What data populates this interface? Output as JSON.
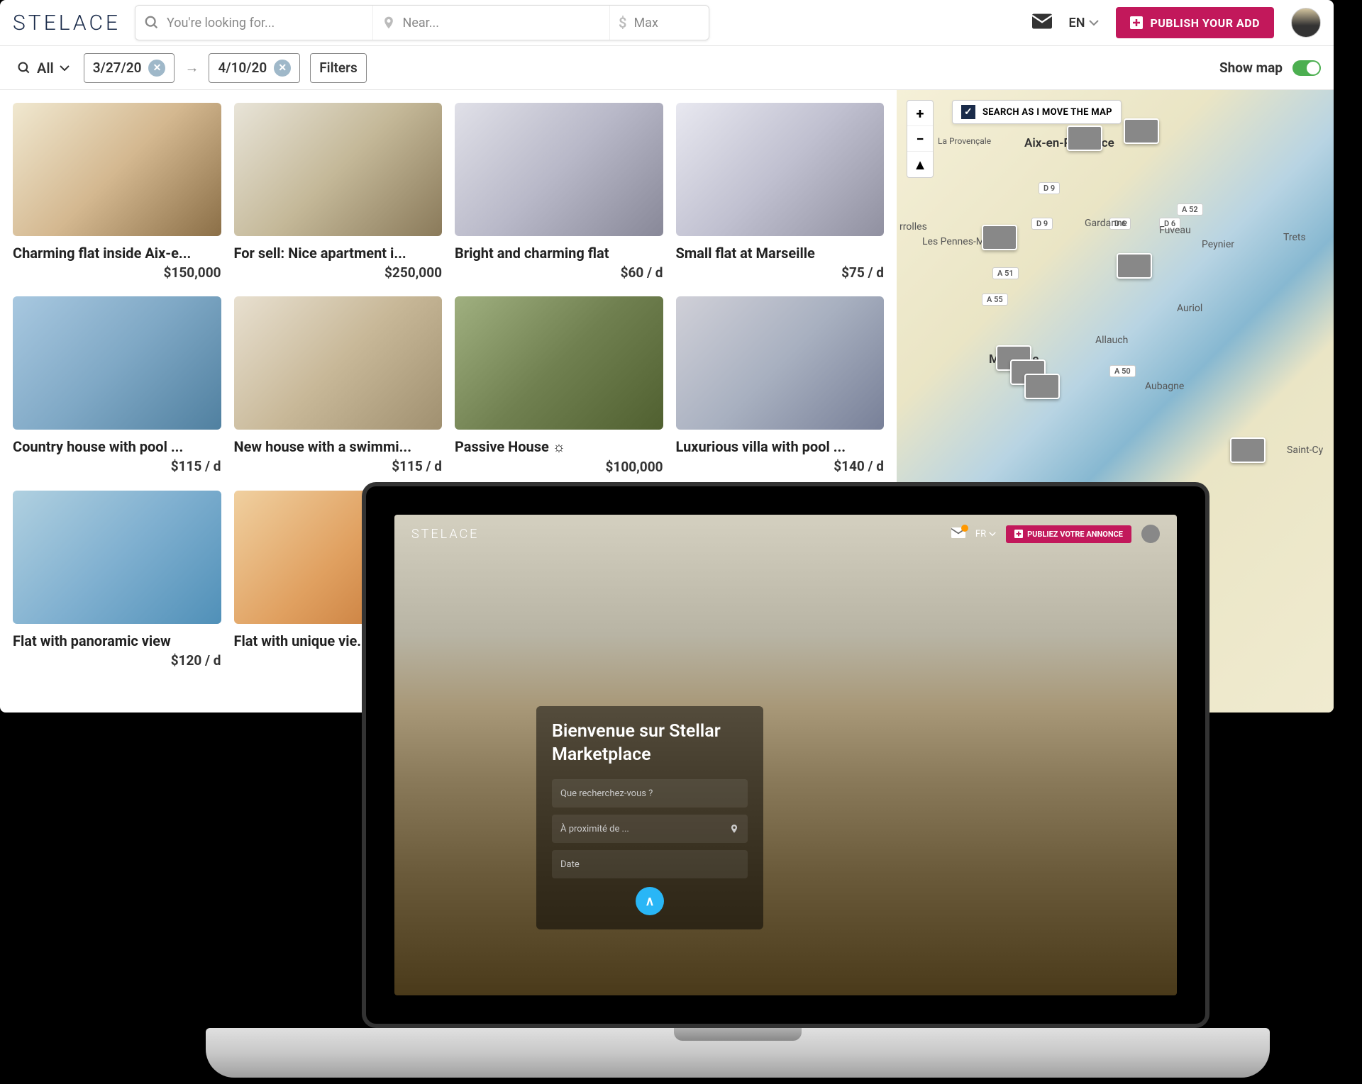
{
  "header": {
    "logo": "STELACE",
    "search_placeholder": "You're looking for...",
    "near_placeholder": "Near...",
    "max_placeholder": "Max",
    "lang": "EN",
    "publish_label": "PUBLISH YOUR ADD"
  },
  "filters": {
    "all_label": "All",
    "date_from": "3/27/20",
    "date_to": "4/10/20",
    "filters_label": "Filters",
    "show_map_label": "Show map"
  },
  "listings": [
    {
      "title": "Charming flat inside Aix-e...",
      "price": "$150,000",
      "img": "img1"
    },
    {
      "title": "For sell: Nice apartment i...",
      "price": "$250,000",
      "img": "img2"
    },
    {
      "title": "Bright and charming flat",
      "price": "$60 / d",
      "img": "img3"
    },
    {
      "title": "Small flat at Marseille",
      "price": "$75 / d",
      "img": "img4"
    },
    {
      "title": "Country house with pool ...",
      "price": "$115 / d",
      "img": "img5"
    },
    {
      "title": "New house with a swimmi...",
      "price": "$115 / d",
      "img": "img6"
    },
    {
      "title": "Passive House ☼",
      "price": "$100,000",
      "img": "img7"
    },
    {
      "title": "Luxurious villa with pool ...",
      "price": "$140 / d",
      "img": "img8"
    },
    {
      "title": "Flat with panoramic view",
      "price": "$120 / d",
      "img": "img9"
    },
    {
      "title": "Flat with unique vie...",
      "price": "",
      "img": "img10"
    }
  ],
  "map": {
    "search_as_move": "SEARCH AS I MOVE THE MAP",
    "cities": {
      "aix": "Aix-en-Provence",
      "marseille": "Marseille",
      "pennes": "Les Pennes-Mirabeau",
      "gardanne": "Gardanne",
      "fuveau": "Fuveau",
      "trets": "Trets",
      "allauch": "Allauch",
      "aubagne": "Aubagne",
      "auriol": "Auriol",
      "peynier": "Peynier",
      "saintcy": "Saint-Cy",
      "rrolles": "rrolles"
    },
    "roads": {
      "d9": "D 9",
      "d9b": "D 9",
      "d6": "D 6",
      "d6b": "D 6",
      "a51": "A 51",
      "a55": "A 55",
      "a50": "A 50",
      "a52": "A 52",
      "provencale": "La Provençale"
    }
  },
  "laptop": {
    "logo": "STELACE",
    "lang": "FR",
    "publish_label": "PUBLIEZ VOTRE ANNONCE",
    "hero_title": "Bienvenue sur Stellar Marketplace",
    "search_placeholder": "Que recherchez-vous ?",
    "near_placeholder": "À proximité de ...",
    "date_placeholder": "Date"
  }
}
